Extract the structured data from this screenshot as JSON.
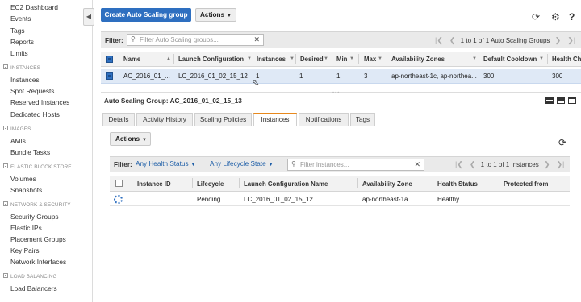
{
  "sidebar": {
    "top_links": [
      "EC2 Dashboard",
      "Events",
      "Tags",
      "Reports",
      "Limits"
    ],
    "sections": [
      {
        "title": "INSTANCES",
        "items": [
          "Instances",
          "Spot Requests",
          "Reserved Instances",
          "Dedicated Hosts"
        ]
      },
      {
        "title": "IMAGES",
        "items": [
          "AMIs",
          "Bundle Tasks"
        ]
      },
      {
        "title": "ELASTIC BLOCK STORE",
        "items": [
          "Volumes",
          "Snapshots"
        ]
      },
      {
        "title": "NETWORK & SECURITY",
        "items": [
          "Security Groups",
          "Elastic IPs",
          "Placement Groups",
          "Key Pairs",
          "Network Interfaces"
        ]
      },
      {
        "title": "LOAD BALANCING",
        "items": [
          "Load Balancers"
        ]
      }
    ]
  },
  "toolbar": {
    "create_label": "Create Auto Scaling group",
    "actions_label": "Actions"
  },
  "asg_filter": {
    "label": "Filter:",
    "placeholder": "Filter Auto Scaling groups...",
    "pager_text": "1 to 1 of 1 Auto Scaling Groups"
  },
  "asg_table": {
    "columns": [
      "Name",
      "Launch Configuration",
      "Instances",
      "Desired",
      "Min",
      "Max",
      "Availability Zones",
      "Default Cooldown",
      "Health Ch"
    ],
    "rows": [
      [
        "AC_2016_01_...",
        "LC_2016_01_02_15_12",
        "1",
        "1",
        "1",
        "3",
        "ap-northeast-1c, ap-northea...",
        "300",
        "300"
      ]
    ]
  },
  "detail": {
    "title": "Auto Scaling Group: AC_2016_01_02_15_13",
    "tabs": [
      "Details",
      "Activity History",
      "Scaling Policies",
      "Instances",
      "Notifications",
      "Tags"
    ],
    "active_tab": "Instances",
    "actions_label": "Actions",
    "filter_label": "Filter:",
    "health_filter": "Any Health Status",
    "lifecycle_filter": "Any Lifecycle State",
    "search_placeholder": "Filter instances...",
    "pager_text": "1 to 1 of 1 Instances",
    "columns": [
      "Instance ID",
      "Lifecycle",
      "Launch Configuration Name",
      "Availability Zone",
      "Health Status",
      "Protected from"
    ],
    "rows": [
      [
        "",
        "Pending",
        "LC_2016_01_02_15_12",
        "ap-northeast-1a",
        "Healthy",
        ""
      ]
    ]
  },
  "icons": {
    "refresh": "refresh-icon",
    "settings": "gear-icon",
    "help": "help-icon",
    "accent_color": "#2e6fc0",
    "active_tab_color": "#e8891d"
  }
}
